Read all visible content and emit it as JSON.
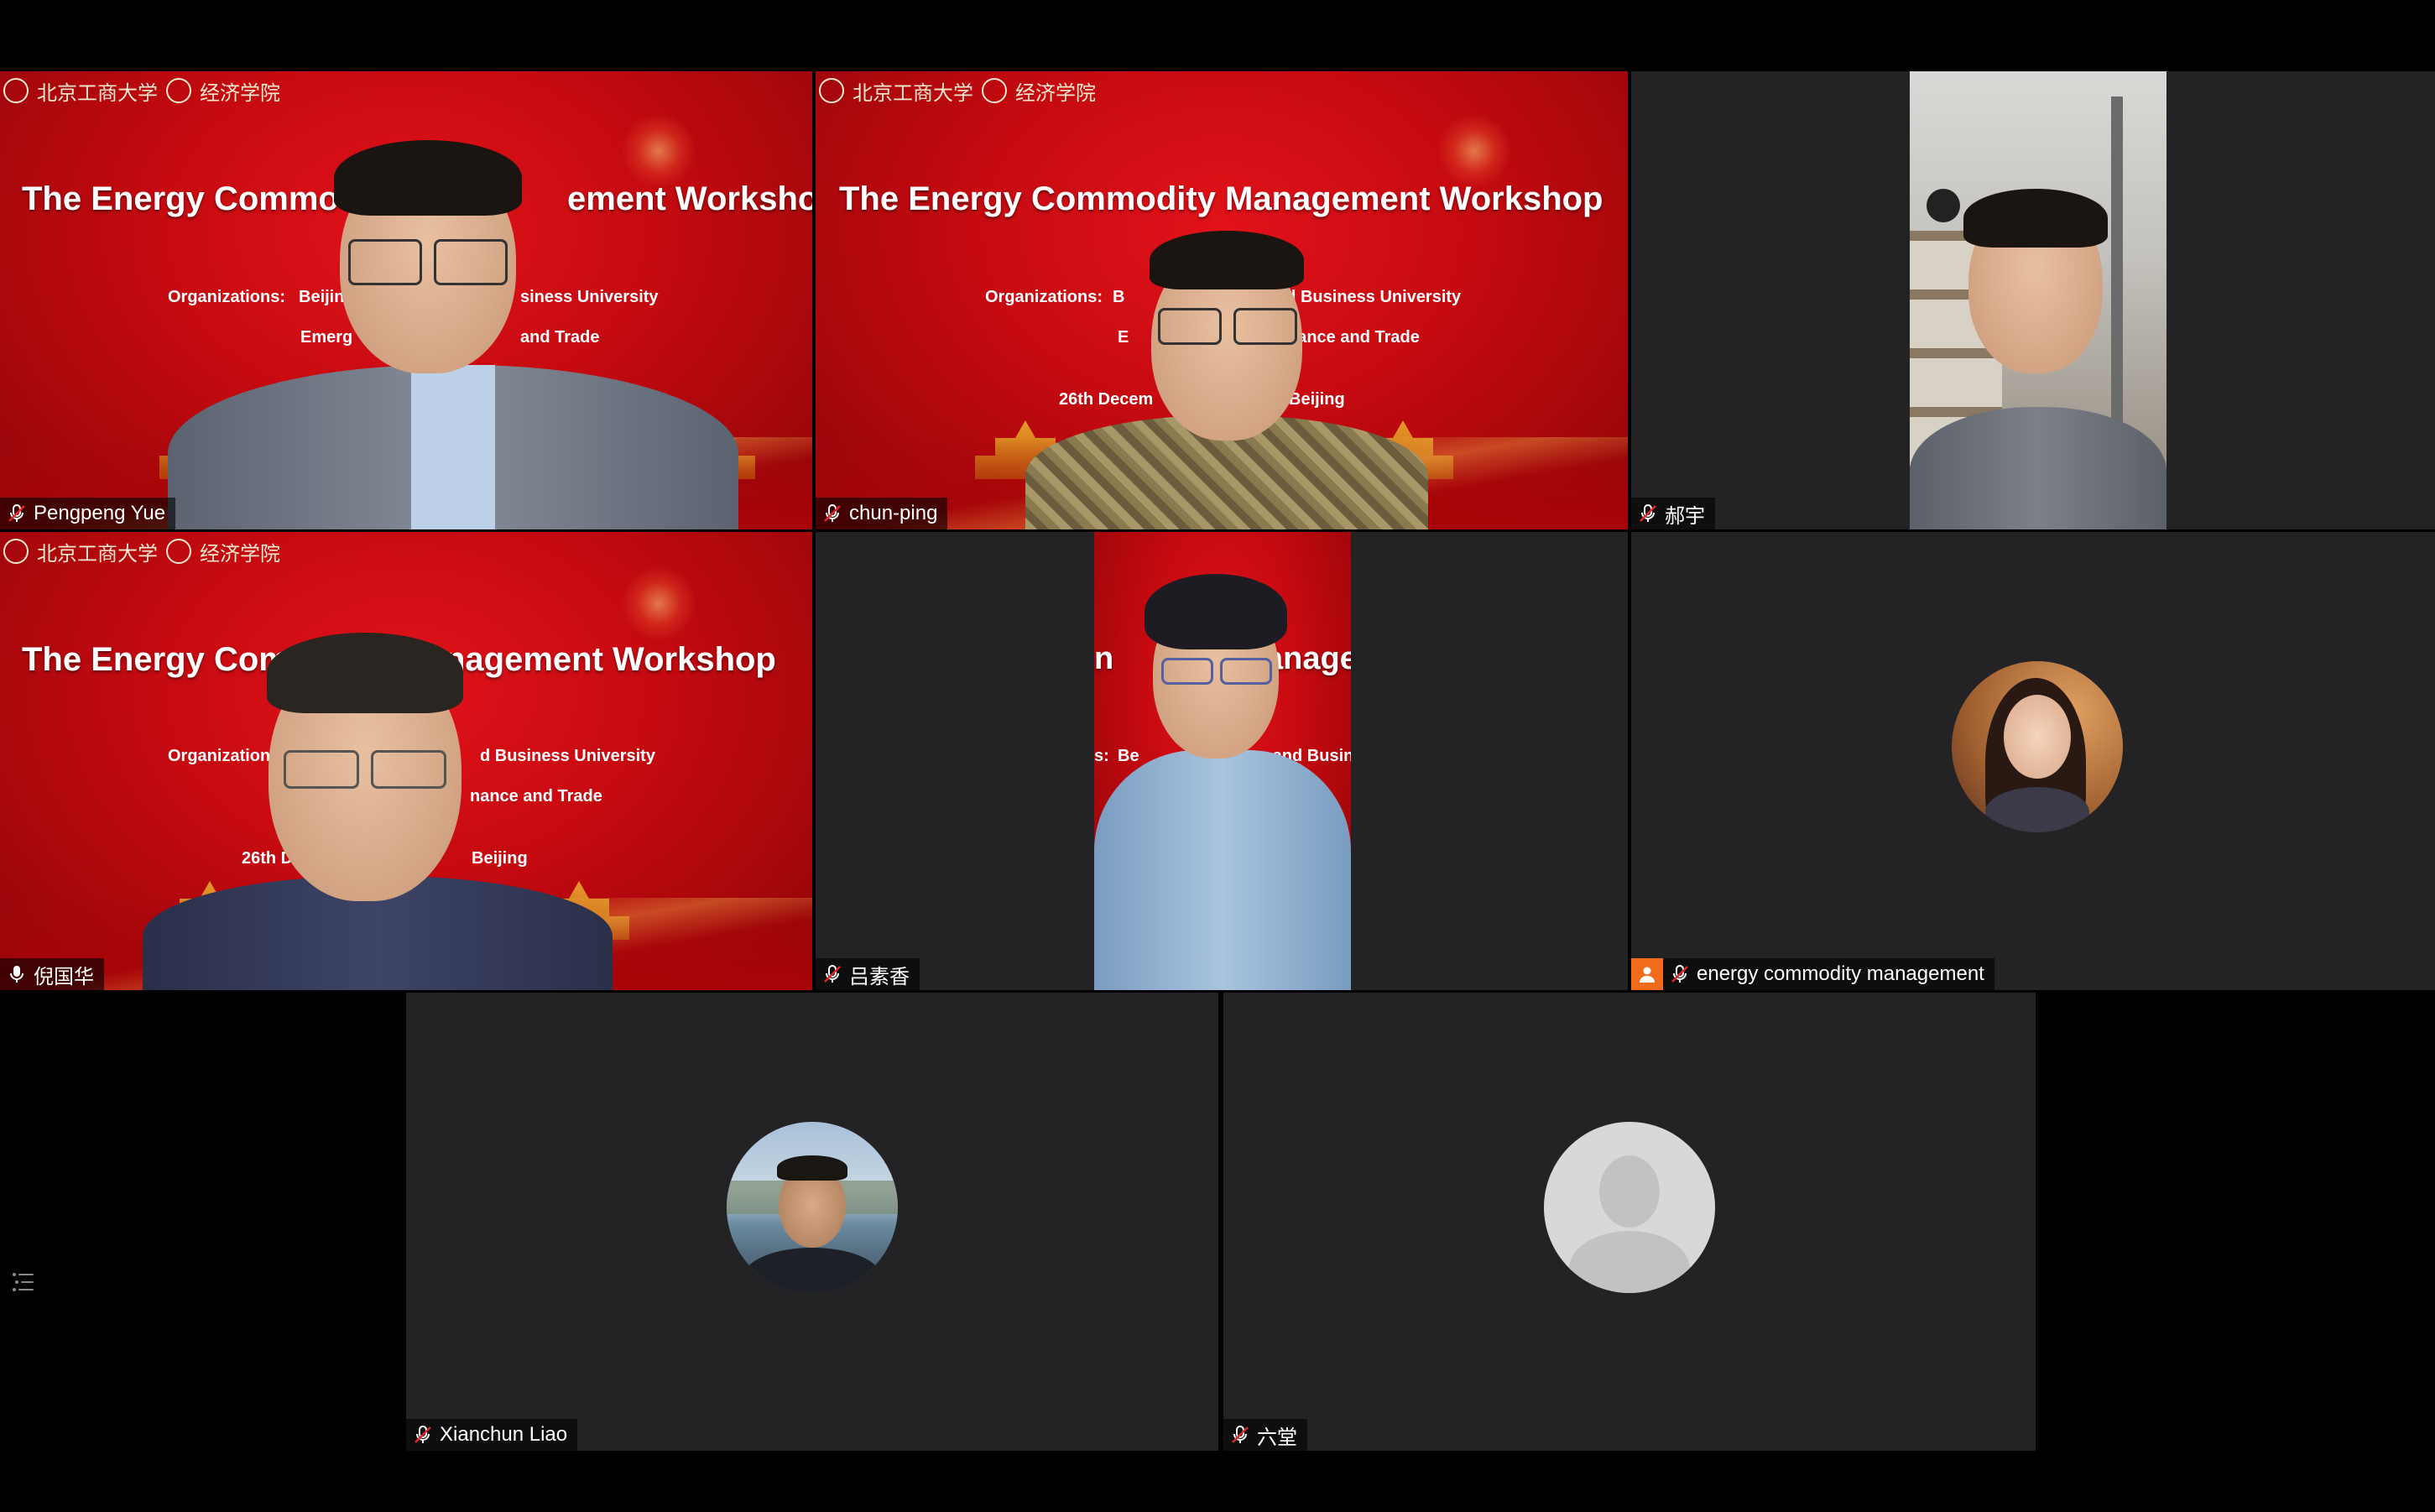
{
  "meeting": {
    "banner": {
      "university": "北京工商大学",
      "school": "经济学院",
      "title": "The Energy Commodity Management Workshop",
      "organizations_label": "Organizations:",
      "org_line1": "Beijing Technology and Business University",
      "org_line2": "Emergency Management of Finance and Trade",
      "date": "26th December",
      "location": "Beijing"
    },
    "tiles": [
      {
        "name": "Pengpeng Yue",
        "mic": "muted"
      },
      {
        "name": "chun-ping",
        "mic": "muted"
      },
      {
        "name": "郝宇",
        "mic": "muted"
      },
      {
        "name": "倪国华",
        "mic": "active"
      },
      {
        "name": "吕素香",
        "mic": "muted"
      },
      {
        "name": "energy commodity management",
        "mic": "muted",
        "host_badge": true
      },
      {
        "name": "Xianchun Liao",
        "mic": "muted"
      },
      {
        "name": "六堂",
        "mic": "muted"
      }
    ],
    "visible_banner_text": {
      "t1_title_left": "The Energy Commo",
      "t1_title_right": "ement Workshop",
      "t1_org_left": "Organizations:",
      "t1_org_mid": "Beijin",
      "t1_org_right": "siness University",
      "t1_line2_left": "Emerg",
      "t1_line2_right": "and Trade",
      "t2_org_left": "Organizations:",
      "t2_org_mid": "B",
      "t2_org_right": "nd Business University",
      "t2_line2_left": "E",
      "t2_line2_right": "nance and Trade",
      "t2_date": "26th Decem",
      "t2_location": "Beijing",
      "t4_title_left": "The Energy Com",
      "t4_title_right": "nagement Workshop",
      "t4_org_left": "Organization",
      "t4_org_right": "d Business University",
      "t4_line2_right": "nance and Trade",
      "t4_date": "26th De",
      "t4_location": "Beijing",
      "t5_title_left": "n",
      "t5_title_right": "anage",
      "t5_org_left": "s:",
      "t5_org_mid": "Be",
      "t5_org_right": "logy and Busin"
    }
  },
  "colors": {
    "tile_bg": "#232325",
    "banner_red": "#c40a10",
    "host_badge": "#f26b1d"
  },
  "icons": {
    "mic_muted": "mic-muted-icon",
    "mic_active": "mic-icon",
    "host_badge": "host-badge-icon",
    "participants_list": "list-icon"
  }
}
